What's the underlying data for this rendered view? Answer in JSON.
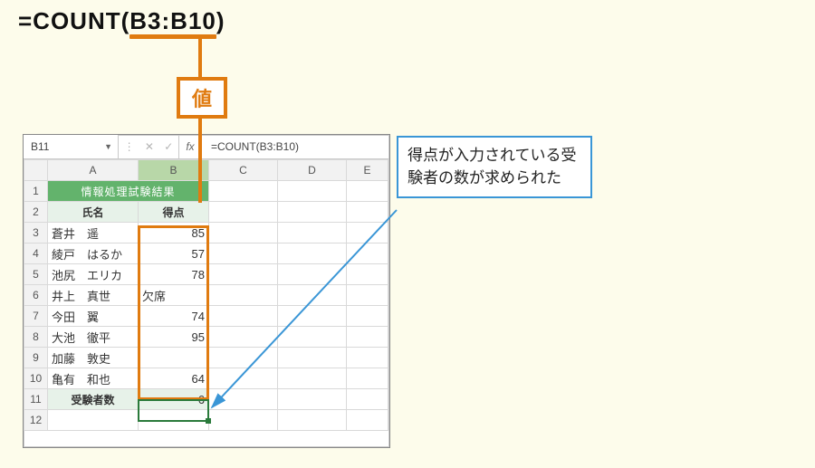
{
  "formula_display": {
    "pre": "=COUNT(",
    "range": "B3:B10",
    "post": ")"
  },
  "value_label": "値",
  "callout_text": "得点が入力されている受験者の数が求められた",
  "namebox": "B11",
  "fx_icons": {
    "dots": "⋮",
    "cancel": "✕",
    "confirm": "✓",
    "fx": "fx"
  },
  "fx_formula": "=COUNT(B3:B10)",
  "columns": [
    "A",
    "B",
    "C",
    "D",
    "E"
  ],
  "row_headers": [
    "1",
    "2",
    "3",
    "4",
    "5",
    "6",
    "7",
    "8",
    "9",
    "10",
    "11",
    "12"
  ],
  "merged_title": "情報処理試験結果",
  "header_row": {
    "name": "氏名",
    "score": "得点"
  },
  "rows": [
    {
      "name": "蒼井　遥",
      "score": "85"
    },
    {
      "name": "綾戸　はるか",
      "score": "57"
    },
    {
      "name": "池尻　エリカ",
      "score": "78"
    },
    {
      "name": "井上　真世",
      "score": "欠席"
    },
    {
      "name": "今田　翼",
      "score": "74"
    },
    {
      "name": "大池　徹平",
      "score": "95"
    },
    {
      "name": "加藤　敦史",
      "score": ""
    },
    {
      "name": "亀有　和也",
      "score": "64"
    }
  ],
  "result_row": {
    "label": "受験者数",
    "value": "6"
  }
}
